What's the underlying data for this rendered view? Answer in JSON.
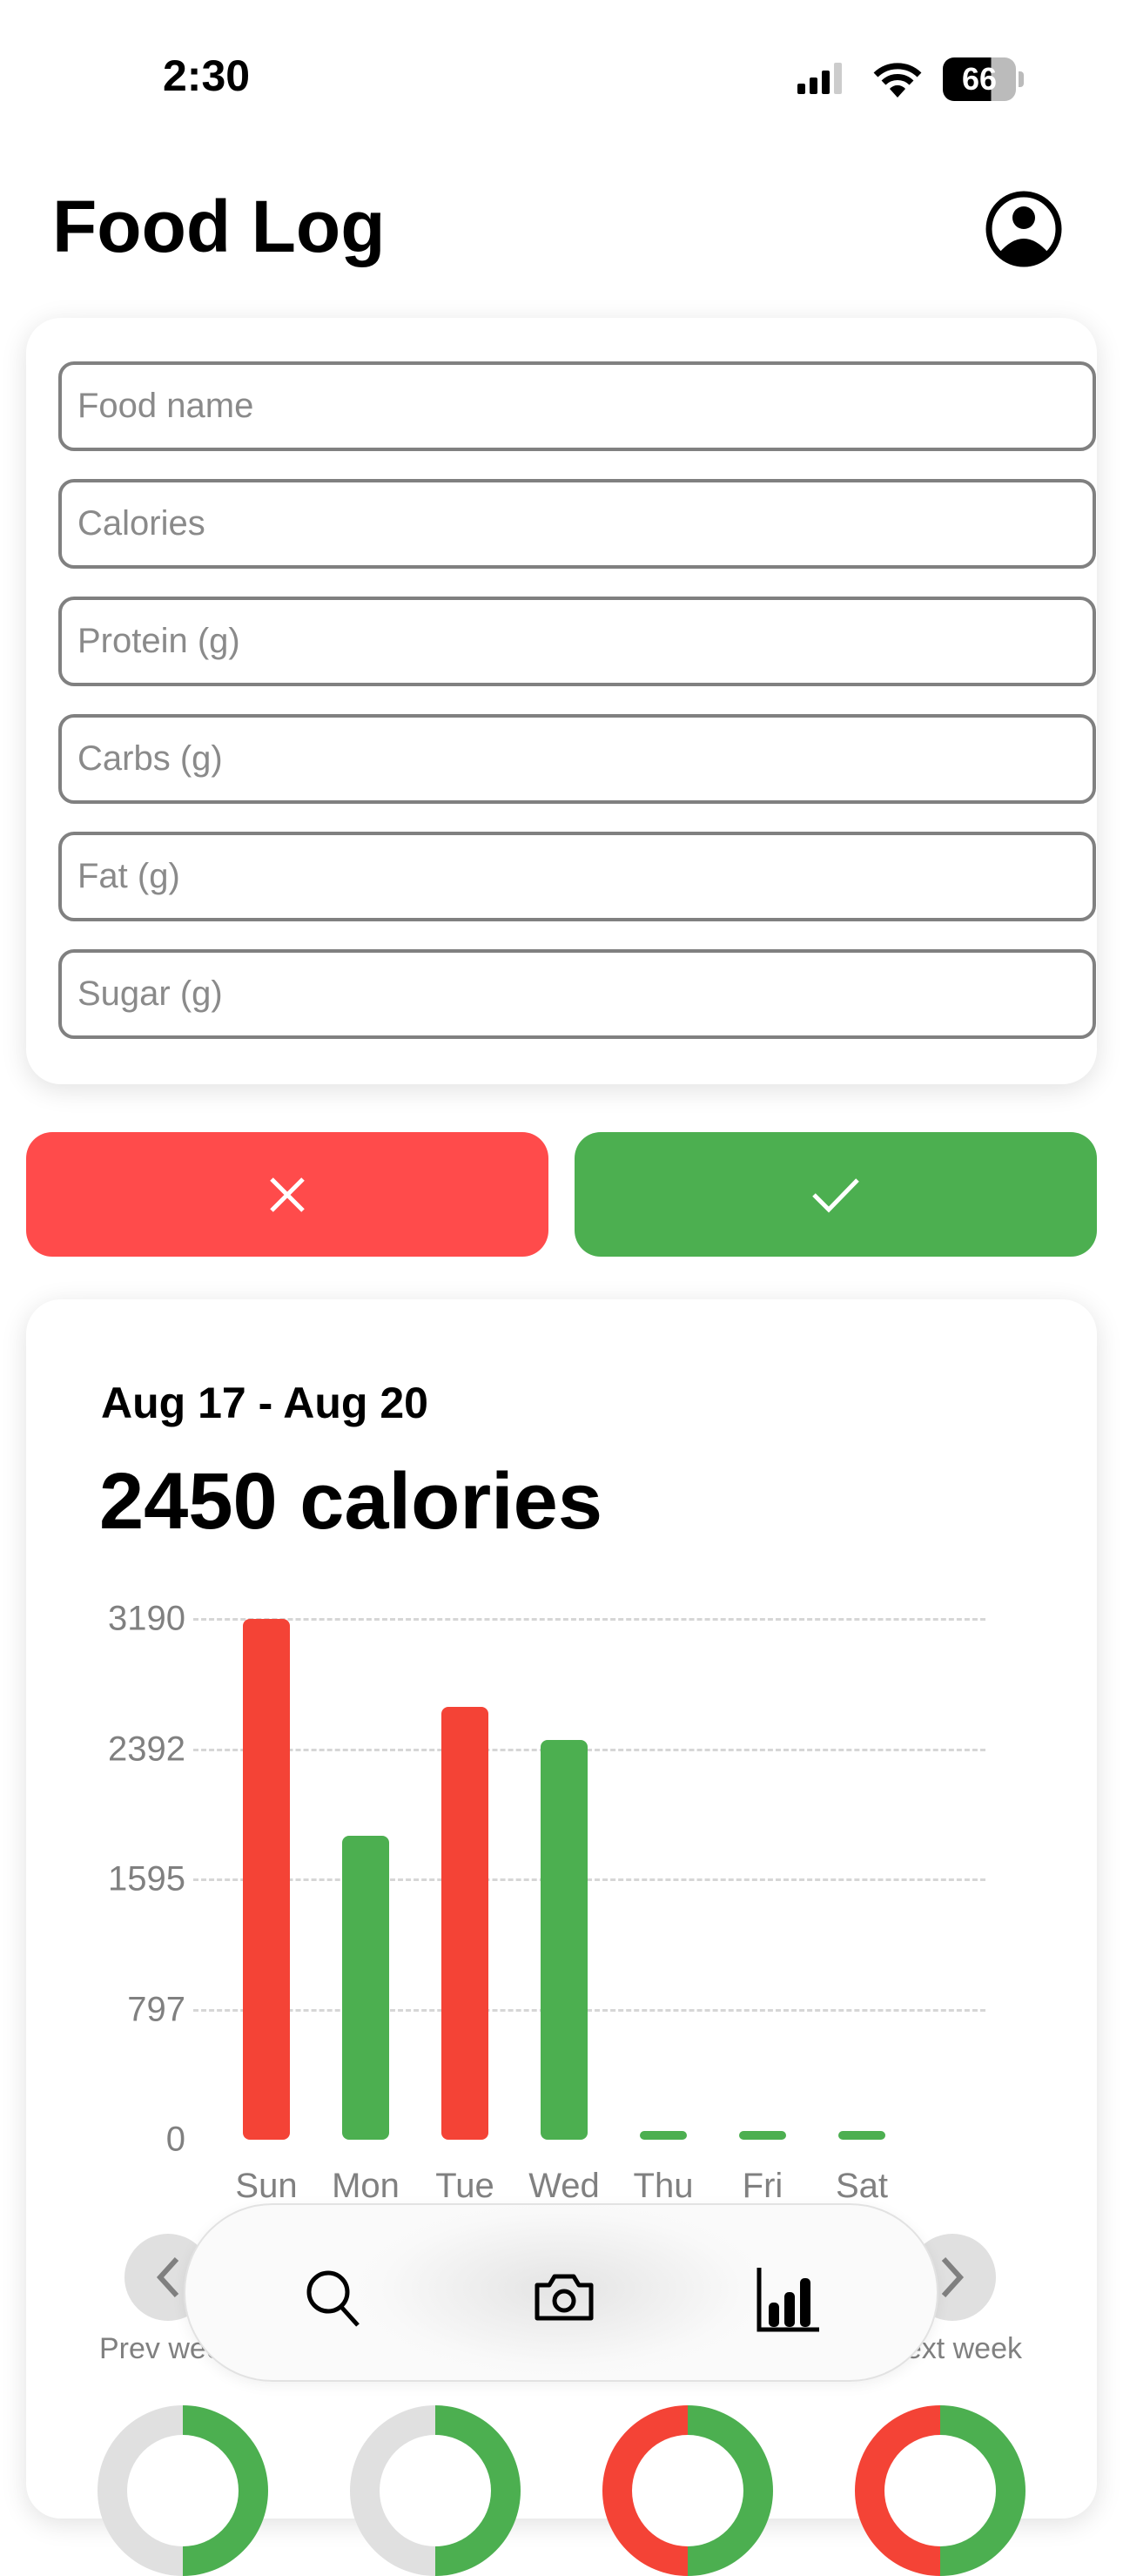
{
  "status_bar": {
    "time": "2:30",
    "battery": "66"
  },
  "header": {
    "title": "Food Log"
  },
  "form": {
    "fields": [
      {
        "placeholder": "Food name",
        "value": ""
      },
      {
        "placeholder": "Calories",
        "value": ""
      },
      {
        "placeholder": "Protein (g)",
        "value": ""
      },
      {
        "placeholder": "Carbs (g)",
        "value": ""
      },
      {
        "placeholder": "Fat (g)",
        "value": ""
      },
      {
        "placeholder": "Sugar (g)",
        "value": ""
      }
    ]
  },
  "colors": {
    "cancel": "#FF4B4B",
    "confirm": "#4CAF50",
    "over": "#F44336",
    "under": "#4CAF50"
  },
  "summary": {
    "date_range": "Aug 17 - Aug 20",
    "calories": "2450 calories"
  },
  "chart_data": {
    "type": "bar",
    "categories": [
      "Sun",
      "Mon",
      "Tue",
      "Wed",
      "Thu",
      "Fri",
      "Sat"
    ],
    "values": [
      3190,
      1860,
      2650,
      2450,
      0,
      0,
      0
    ],
    "bar_colors": [
      "#F44336",
      "#4CAF50",
      "#F44336",
      "#4CAF50",
      "#4CAF50",
      "#4CAF50",
      "#4CAF50"
    ],
    "yticks": [
      "0",
      "797",
      "1595",
      "2392",
      "3190"
    ],
    "ylim": [
      0,
      3190
    ],
    "grid": true,
    "title": "",
    "xlabel": "",
    "ylabel": ""
  },
  "week_nav": {
    "prev": "Prev week",
    "next": "Next week"
  },
  "tab_bar": {
    "icons": [
      "search-icon",
      "camera-icon",
      "chart-icon"
    ]
  }
}
